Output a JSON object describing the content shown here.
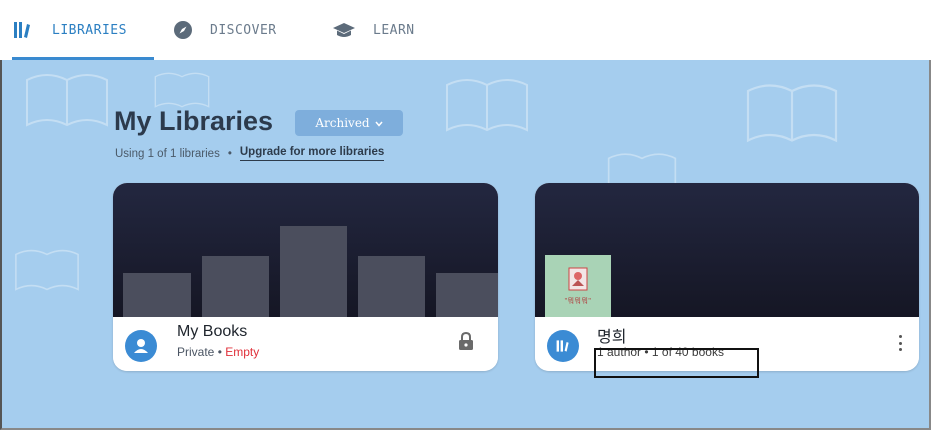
{
  "nav": {
    "tabs": [
      {
        "label": "LIBRARIES",
        "icon": "libraries-icon",
        "active": true
      },
      {
        "label": "DISCOVER",
        "icon": "compass-icon",
        "active": false
      },
      {
        "label": "LEARN",
        "icon": "graduation-cap-icon",
        "active": false
      }
    ]
  },
  "header": {
    "title": "My Libraries",
    "archived_label": "Archived",
    "usage_text": "Using 1 of 1 libraries",
    "separator": "•",
    "upgrade_label": "Upgrade for more libraries"
  },
  "libraries": [
    {
      "name": "My Books",
      "privacy": "Private",
      "separator": " • ",
      "status": "Empty",
      "icon": "lock-icon"
    },
    {
      "name": "명희",
      "meta": "1 author • 1 of 40 books",
      "thumb_text": "\"뭐뭐뭐\"",
      "icon": "more-vert-icon"
    }
  ],
  "colors": {
    "accent": "#2b7fc2",
    "background": "#a5cdee",
    "empty_status": "#e0303a",
    "cover_dark": "#151624"
  }
}
